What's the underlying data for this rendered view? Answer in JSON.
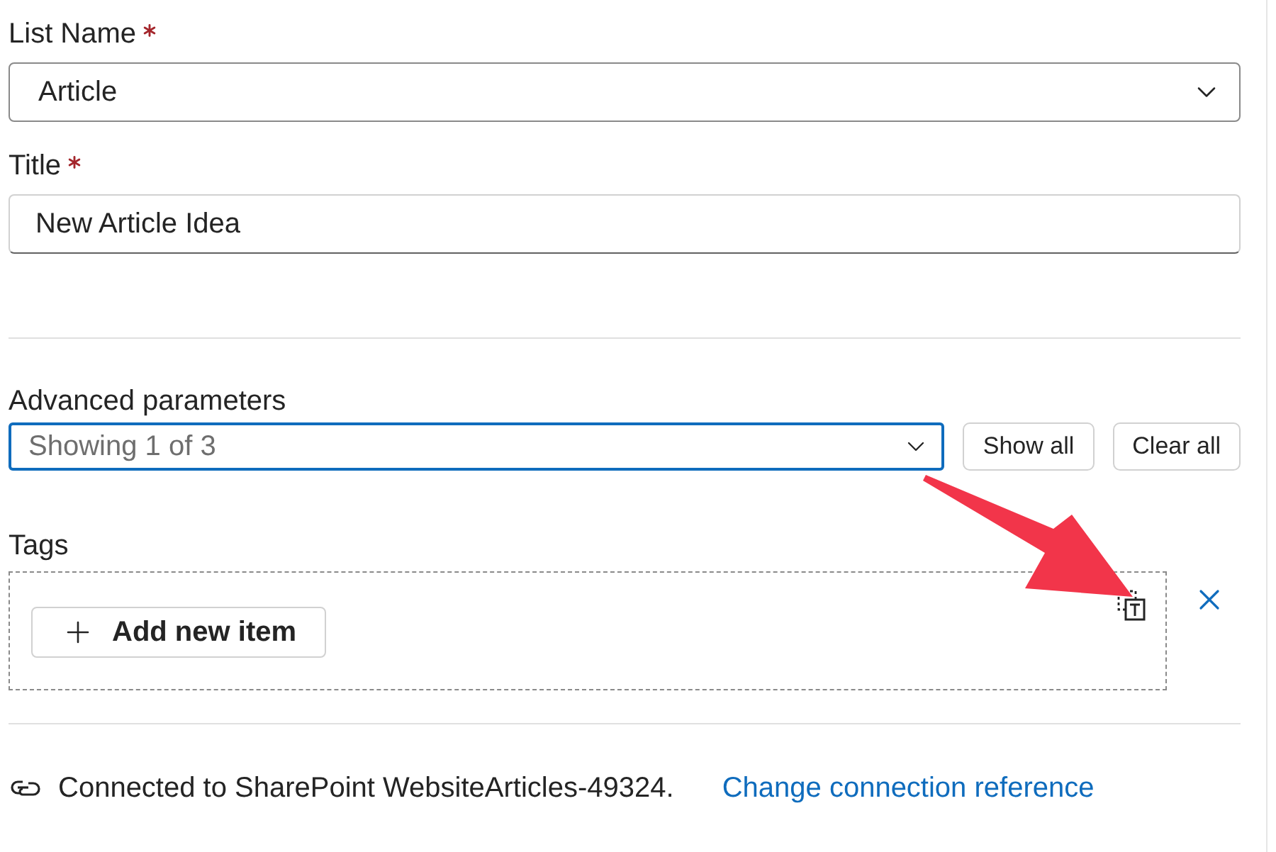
{
  "fields": [
    {
      "kind": "dropdown",
      "label": "List Name",
      "required": true,
      "value": "Article"
    },
    {
      "kind": "text",
      "label": "Title",
      "required": true,
      "value": "New Article Idea"
    }
  ],
  "advanced": {
    "label": "Advanced parameters",
    "dropdown": {
      "placeholder": "Showing 1 of 3",
      "focused": true
    },
    "buttons": [
      "Show all",
      "Clear all"
    ]
  },
  "tags": {
    "label": "Tags",
    "add_button": "Add new item"
  },
  "connection": {
    "text": "Connected to SharePoint WebsiteArticles-49324.",
    "link": "Change connection reference"
  }
}
